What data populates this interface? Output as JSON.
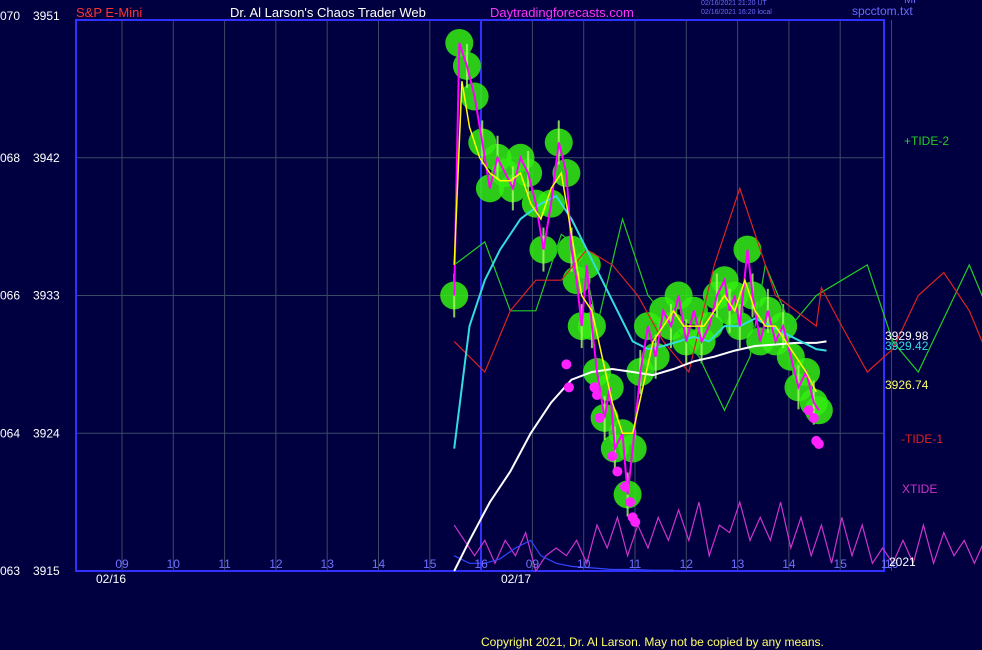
{
  "header": {
    "left_label": "S&P E-Mini",
    "title": "Dr. Al Larson's Chaos Trader Web",
    "site": "Daytradingforecasts.com",
    "stamp_line1": "02/16/2021 21:20 UT",
    "stamp_line2": "02/16/2021 16:20 local",
    "corner_top": "MP",
    "corner_bottom": "spcctom.txt"
  },
  "footer": {
    "copyright": "Copyright 2021, Dr. Al Larson. May not be copied by any means."
  },
  "colors": {
    "background": "#000040",
    "grid": "#3b4a66",
    "frame": "#3030ff",
    "price": "#ff00ff",
    "fast_ma": "#ffff00",
    "mid_ma": "#33dddd",
    "slow_ma": "#ffffff",
    "tide_plus2": "#22cc22",
    "tide_minus1": "#dd2222",
    "xtide": "#cc33cc",
    "glow": "#33ee11"
  },
  "chart_data": {
    "type": "line",
    "title": "S&P E-Mini",
    "ylim": [
      3915,
      3951
    ],
    "y_ticks": [
      {
        "left": "063",
        "right": "3915",
        "value": 3915
      },
      {
        "left": "064",
        "right": "3924",
        "value": 3924
      },
      {
        "left": "066",
        "right": "3933",
        "value": 3933
      },
      {
        "left": "068",
        "right": "3942",
        "value": 3942
      },
      {
        "left": "070",
        "right": "3951",
        "value": 3951
      }
    ],
    "x_hour_ticks": [
      "09",
      "10",
      "11",
      "12",
      "13",
      "14",
      "15",
      "16",
      "09",
      "10",
      "11",
      "12",
      "13",
      "14",
      "15",
      "16"
    ],
    "date_labels": [
      "02/16",
      "02/17"
    ],
    "year_label": "2021",
    "right_values": [
      {
        "label": "3929.98",
        "color": "#ffffff",
        "value": 3929.98
      },
      {
        "label": "3929.42",
        "color": "#33dddd",
        "value": 3929.42
      },
      {
        "label": "3926.74",
        "color": "#ffff66",
        "value": 3926.74
      }
    ],
    "series_labels": [
      {
        "name": "+TIDE-2",
        "color": "#22cc22"
      },
      {
        "name": "-TIDE-1",
        "color": "#dd2222"
      },
      {
        "name": "XTIDE",
        "color": "#cc33cc"
      }
    ],
    "price": [
      [
        8.5,
        3933
      ],
      [
        8.6,
        3949.5
      ],
      [
        8.75,
        3948
      ],
      [
        8.9,
        3946
      ],
      [
        9.05,
        3943
      ],
      [
        9.2,
        3940
      ],
      [
        9.35,
        3942
      ],
      [
        9.5,
        3941
      ],
      [
        9.65,
        3940
      ],
      [
        9.8,
        3942
      ],
      [
        9.95,
        3941
      ],
      [
        10.1,
        3939
      ],
      [
        10.25,
        3936
      ],
      [
        10.4,
        3939
      ],
      [
        10.55,
        3943
      ],
      [
        10.7,
        3941
      ],
      [
        10.8,
        3936
      ],
      [
        10.9,
        3934
      ],
      [
        11.0,
        3931
      ],
      [
        11.1,
        3935
      ],
      [
        11.2,
        3931
      ],
      [
        11.3,
        3928
      ],
      [
        11.45,
        3925
      ],
      [
        11.55,
        3927
      ],
      [
        11.65,
        3923
      ],
      [
        11.8,
        3924
      ],
      [
        11.9,
        3920
      ],
      [
        12.0,
        3923
      ],
      [
        12.15,
        3928
      ],
      [
        12.3,
        3931
      ],
      [
        12.45,
        3929
      ],
      [
        12.6,
        3932
      ],
      [
        12.75,
        3931
      ],
      [
        12.9,
        3933
      ],
      [
        13.05,
        3930
      ],
      [
        13.2,
        3932
      ],
      [
        13.35,
        3930
      ],
      [
        13.5,
        3931
      ],
      [
        13.65,
        3933
      ],
      [
        13.8,
        3934
      ],
      [
        13.9,
        3932
      ],
      [
        14.0,
        3933
      ],
      [
        14.1,
        3931
      ],
      [
        14.25,
        3936
      ],
      [
        14.35,
        3933
      ],
      [
        14.5,
        3930
      ],
      [
        14.65,
        3932
      ],
      [
        14.8,
        3930
      ],
      [
        14.95,
        3931
      ],
      [
        15.1,
        3929
      ],
      [
        15.25,
        3927
      ],
      [
        15.4,
        3928
      ],
      [
        15.55,
        3926
      ],
      [
        15.65,
        3925.5
      ]
    ],
    "fast_ma": [
      [
        8.5,
        3935
      ],
      [
        8.65,
        3947
      ],
      [
        8.8,
        3944
      ],
      [
        9.0,
        3942
      ],
      [
        9.2,
        3941
      ],
      [
        9.4,
        3940.5
      ],
      [
        9.6,
        3940.5
      ],
      [
        9.8,
        3941
      ],
      [
        10.0,
        3939
      ],
      [
        10.2,
        3938
      ],
      [
        10.4,
        3940
      ],
      [
        10.6,
        3941
      ],
      [
        10.8,
        3937
      ],
      [
        11.0,
        3933
      ],
      [
        11.2,
        3932
      ],
      [
        11.4,
        3929
      ],
      [
        11.6,
        3926
      ],
      [
        11.8,
        3924
      ],
      [
        12.0,
        3924
      ],
      [
        12.2,
        3927
      ],
      [
        12.4,
        3930
      ],
      [
        12.6,
        3931
      ],
      [
        12.8,
        3932
      ],
      [
        13.0,
        3931
      ],
      [
        13.2,
        3931
      ],
      [
        13.4,
        3931
      ],
      [
        13.6,
        3932
      ],
      [
        13.8,
        3933
      ],
      [
        14.0,
        3932
      ],
      [
        14.2,
        3934
      ],
      [
        14.4,
        3932
      ],
      [
        14.6,
        3931
      ],
      [
        14.8,
        3931
      ],
      [
        15.0,
        3930
      ],
      [
        15.2,
        3929
      ],
      [
        15.4,
        3928
      ],
      [
        15.6,
        3926.7
      ]
    ],
    "mid_ma": [
      [
        8.5,
        3923
      ],
      [
        8.8,
        3931
      ],
      [
        9.1,
        3934
      ],
      [
        9.4,
        3936
      ],
      [
        9.8,
        3938
      ],
      [
        10.2,
        3939
      ],
      [
        10.5,
        3939.5
      ],
      [
        10.8,
        3938
      ],
      [
        11.1,
        3936
      ],
      [
        11.4,
        3934
      ],
      [
        11.7,
        3932
      ],
      [
        12.0,
        3930
      ],
      [
        12.3,
        3929.5
      ],
      [
        12.6,
        3929.7
      ],
      [
        12.9,
        3930
      ],
      [
        13.2,
        3930.3
      ],
      [
        13.5,
        3930
      ],
      [
        13.8,
        3931
      ],
      [
        14.1,
        3931
      ],
      [
        14.4,
        3931.5
      ],
      [
        14.7,
        3931
      ],
      [
        15.0,
        3930.5
      ],
      [
        15.3,
        3930
      ],
      [
        15.6,
        3929.5
      ],
      [
        15.8,
        3929.4
      ]
    ],
    "slow_ma": [
      [
        8.5,
        3915
      ],
      [
        8.8,
        3917
      ],
      [
        9.2,
        3919.5
      ],
      [
        9.6,
        3921.5
      ],
      [
        10.0,
        3924
      ],
      [
        10.4,
        3926
      ],
      [
        10.8,
        3927.5
      ],
      [
        11.2,
        3928
      ],
      [
        11.6,
        3928.2
      ],
      [
        12.0,
        3928
      ],
      [
        12.4,
        3927.8
      ],
      [
        12.8,
        3928.2
      ],
      [
        13.2,
        3928.7
      ],
      [
        13.6,
        3929
      ],
      [
        14.0,
        3929.4
      ],
      [
        14.4,
        3929.7
      ],
      [
        14.8,
        3929.8
      ],
      [
        15.2,
        3929.9
      ],
      [
        15.6,
        3929.9
      ],
      [
        15.8,
        3930
      ]
    ],
    "tide_plus2": [
      [
        8.5,
        3935
      ],
      [
        9.1,
        3936.5
      ],
      [
        9.6,
        3932
      ],
      [
        10.1,
        3932
      ],
      [
        10.6,
        3937
      ],
      [
        11.0,
        3936
      ],
      [
        11.3,
        3931
      ],
      [
        11.8,
        3938
      ],
      [
        12.3,
        3933
      ],
      [
        12.8,
        3931
      ],
      [
        13.3,
        3929
      ],
      [
        13.8,
        3925.5
      ],
      [
        14.3,
        3929
      ],
      [
        14.6,
        3935
      ],
      [
        15.1,
        3931
      ],
      [
        15.6,
        3933
      ],
      [
        16.1,
        3934
      ],
      [
        16.6,
        3935
      ],
      [
        17.1,
        3930
      ],
      [
        17.6,
        3928
      ],
      [
        18.1,
        3931.5
      ],
      [
        18.6,
        3935
      ],
      [
        19.1,
        3931
      ],
      [
        19.6,
        3928
      ],
      [
        20.1,
        3929
      ],
      [
        20.6,
        3935.5
      ],
      [
        20.7,
        3933.5
      ],
      [
        21.1,
        3932
      ],
      [
        21.5,
        3931
      ],
      [
        22.0,
        3929.5
      ],
      [
        22.1,
        3930.5
      ],
      [
        22.2,
        3927.5
      ],
      [
        22.5,
        3934
      ],
      [
        23.0,
        3942
      ],
      [
        23.4,
        3946.5
      ],
      [
        23.7,
        3947
      ],
      [
        23.8,
        3944
      ],
      [
        24.0,
        3943
      ],
      [
        24.1,
        3942
      ]
    ],
    "tide_minus1": [
      [
        8.5,
        3930
      ],
      [
        9.1,
        3928
      ],
      [
        9.6,
        3932
      ],
      [
        10.1,
        3934
      ],
      [
        10.6,
        3934
      ],
      [
        11.1,
        3936
      ],
      [
        11.6,
        3935
      ],
      [
        12.1,
        3933
      ],
      [
        12.6,
        3930
      ],
      [
        13.1,
        3928
      ],
      [
        13.6,
        3935
      ],
      [
        14.1,
        3940
      ],
      [
        14.4,
        3937
      ],
      [
        14.8,
        3933
      ],
      [
        15.2,
        3932
      ],
      [
        15.6,
        3931
      ],
      [
        15.7,
        3933.5
      ],
      [
        16.1,
        3931
      ],
      [
        16.6,
        3928
      ],
      [
        17.1,
        3929.5
      ],
      [
        17.6,
        3933
      ],
      [
        18.1,
        3934.5
      ],
      [
        18.6,
        3932
      ],
      [
        19.1,
        3928
      ],
      [
        19.5,
        3930
      ],
      [
        19.7,
        3931
      ],
      [
        20.2,
        3933
      ],
      [
        20.6,
        3934
      ],
      [
        20.8,
        3935.5
      ],
      [
        21.1,
        3933
      ],
      [
        21.6,
        3928
      ],
      [
        22.1,
        3922
      ],
      [
        22.6,
        3918.5
      ],
      [
        22.9,
        3918
      ],
      [
        23.2,
        3918
      ],
      [
        23.25,
        3919.5
      ],
      [
        23.6,
        3920.5
      ],
      [
        23.9,
        3922
      ],
      [
        24.1,
        3923
      ]
    ],
    "xtide": [
      [
        8.5,
        3918
      ],
      [
        8.7,
        3917
      ],
      [
        8.9,
        3916
      ],
      [
        9.1,
        3917
      ],
      [
        9.3,
        3915.5
      ],
      [
        9.5,
        3917
      ],
      [
        9.7,
        3916
      ],
      [
        9.9,
        3917.5
      ],
      [
        10.1,
        3915
      ],
      [
        10.3,
        3916
      ],
      [
        10.5,
        3916.5
      ],
      [
        10.7,
        3916
      ],
      [
        10.9,
        3917
      ],
      [
        11.1,
        3915.5
      ],
      [
        11.3,
        3918
      ],
      [
        11.5,
        3916.5
      ],
      [
        11.7,
        3918.5
      ],
      [
        11.9,
        3916
      ],
      [
        12.1,
        3918
      ],
      [
        12.3,
        3916.5
      ],
      [
        12.5,
        3918.5
      ],
      [
        12.7,
        3917
      ],
      [
        12.9,
        3919
      ],
      [
        13.1,
        3917
      ],
      [
        13.3,
        3919.5
      ],
      [
        13.5,
        3916
      ],
      [
        13.7,
        3918
      ],
      [
        13.9,
        3917.5
      ],
      [
        14.1,
        3919.5
      ],
      [
        14.3,
        3917
      ],
      [
        14.5,
        3918.5
      ],
      [
        14.7,
        3917
      ],
      [
        14.9,
        3919.5
      ],
      [
        15.1,
        3916.5
      ],
      [
        15.3,
        3918.5
      ],
      [
        15.5,
        3916
      ],
      [
        15.7,
        3918
      ],
      [
        15.9,
        3915.5
      ],
      [
        16.1,
        3918.5
      ],
      [
        16.3,
        3916
      ],
      [
        16.5,
        3918
      ],
      [
        16.7,
        3915.5
      ],
      [
        16.9,
        3916.5
      ],
      [
        17.1,
        3915.5
      ],
      [
        17.3,
        3917
      ],
      [
        17.5,
        3915.5
      ],
      [
        17.7,
        3918
      ],
      [
        17.9,
        3915.5
      ],
      [
        18.1,
        3917.5
      ],
      [
        18.3,
        3916
      ],
      [
        18.5,
        3917
      ],
      [
        18.7,
        3915.5
      ],
      [
        18.9,
        3917
      ],
      [
        19.1,
        3916
      ],
      [
        19.3,
        3919
      ],
      [
        19.5,
        3917
      ],
      [
        19.7,
        3918.5
      ],
      [
        19.9,
        3916.5
      ],
      [
        20.1,
        3920
      ],
      [
        20.2,
        3918
      ],
      [
        20.4,
        3917
      ],
      [
        20.6,
        3919
      ],
      [
        20.8,
        3916
      ],
      [
        21.0,
        3917.5
      ],
      [
        21.2,
        3917
      ],
      [
        21.4,
        3918
      ],
      [
        21.6,
        3917
      ],
      [
        21.8,
        3916.5
      ],
      [
        22.0,
        3917.5
      ],
      [
        22.2,
        3916
      ],
      [
        22.4,
        3917
      ],
      [
        22.6,
        3918
      ],
      [
        22.8,
        3916.5
      ],
      [
        23.0,
        3917
      ],
      [
        23.2,
        3917.5
      ],
      [
        23.4,
        3917
      ],
      [
        23.6,
        3918.5
      ],
      [
        23.8,
        3916
      ],
      [
        24.0,
        3918
      ],
      [
        24.1,
        3918
      ]
    ],
    "rsi_line": [
      [
        8.5,
        3916
      ],
      [
        8.8,
        3915.5
      ],
      [
        9.1,
        3915.5
      ],
      [
        9.4,
        3915.8
      ],
      [
        9.7,
        3916.5
      ],
      [
        10.0,
        3917
      ],
      [
        10.2,
        3916
      ],
      [
        10.5,
        3915.5
      ],
      [
        10.8,
        3915.3
      ],
      [
        11.2,
        3915.2
      ],
      [
        11.6,
        3915.1
      ],
      [
        12.0,
        3915.1
      ],
      [
        12.4,
        3915.05
      ],
      [
        12.8,
        3915.05
      ]
    ],
    "dots": [
      [
        10.7,
        3928.5
      ],
      [
        10.75,
        3927
      ],
      [
        11.25,
        3927
      ],
      [
        11.3,
        3926.5
      ],
      [
        11.35,
        3925
      ],
      [
        11.6,
        3922.5
      ],
      [
        11.7,
        3921.5
      ],
      [
        11.85,
        3920.5
      ],
      [
        11.95,
        3919.5
      ],
      [
        12.0,
        3918.5
      ],
      [
        12.05,
        3918.2
      ],
      [
        15.45,
        3925.5
      ],
      [
        15.55,
        3925
      ],
      [
        15.6,
        3923.5
      ],
      [
        15.65,
        3923.3
      ]
    ]
  }
}
